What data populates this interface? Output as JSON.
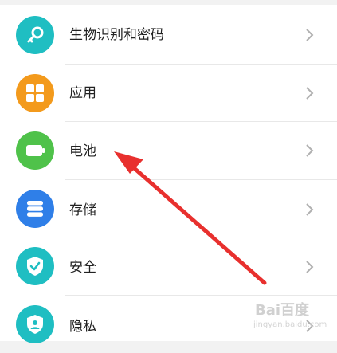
{
  "settings": {
    "items": [
      {
        "label": "生物识别和密码",
        "icon": "key-icon",
        "color": "#1fbec2"
      },
      {
        "label": "应用",
        "icon": "apps-grid-icon",
        "color": "#f39a1c"
      },
      {
        "label": "电池",
        "icon": "battery-icon",
        "color": "#4fc24a"
      },
      {
        "label": "存储",
        "icon": "storage-icon",
        "color": "#2f7fe8"
      },
      {
        "label": "安全",
        "icon": "shield-icon",
        "color": "#1fbec2"
      },
      {
        "label": "隐私",
        "icon": "privacy-icon",
        "color": "#1fbec2"
      }
    ]
  },
  "annotation": {
    "arrow_color": "#e8302e"
  },
  "watermark": {
    "brand": "Bai百度",
    "sub": "jingyan.baidu.com"
  }
}
